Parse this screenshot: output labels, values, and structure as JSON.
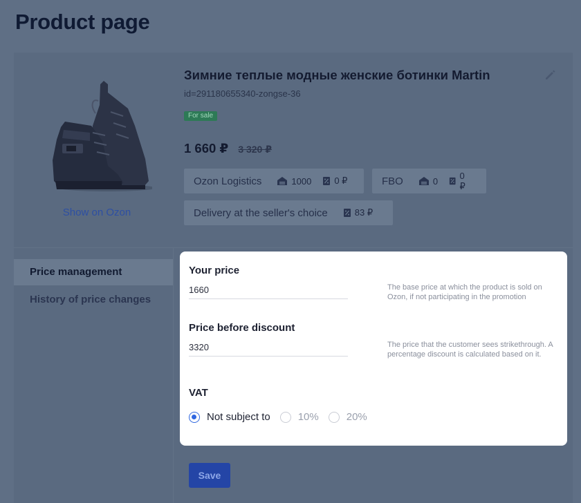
{
  "page": {
    "title": "Product page"
  },
  "product": {
    "name": "Зимние теплые модные женские ботинки Martin",
    "id_text": "id=291180655340-zongse-36",
    "status_badge": "For sale",
    "price": "1 660 ₽",
    "old_price": "3 320 ₽",
    "show_link": "Show on Ozon",
    "logistics": [
      {
        "label": "Ozon Logistics",
        "stock": "1000",
        "fee": "0 ₽"
      },
      {
        "label": "FBO",
        "stock": "0",
        "fee": "0 ₽"
      }
    ],
    "delivery": {
      "label": "Delivery at the seller's choice",
      "fee": "83 ₽"
    }
  },
  "nav": {
    "items": [
      {
        "label": "Price management",
        "active": true
      },
      {
        "label": "History of price changes",
        "active": false
      }
    ]
  },
  "form": {
    "your_price": {
      "label": "Your price",
      "value": "1660",
      "hint": "The base price at which the product is sold on Ozon, if not participating in the promotion"
    },
    "price_before_discount": {
      "label": "Price before discount",
      "value": "3320",
      "hint": "The price that the customer sees strikethrough. A percentage discount is calculated based on it."
    },
    "vat": {
      "label": "VAT",
      "options": [
        "Not subject to",
        "10%",
        "20%"
      ],
      "selected": "Not subject to"
    },
    "save_label": "Save"
  },
  "colors": {
    "accent": "#2f67e0",
    "badge_green": "#2d7a56",
    "overlay": "#5f6f85"
  },
  "icons": [
    "boot-image",
    "pencil-icon",
    "warehouse-icon",
    "fee-icon"
  ]
}
